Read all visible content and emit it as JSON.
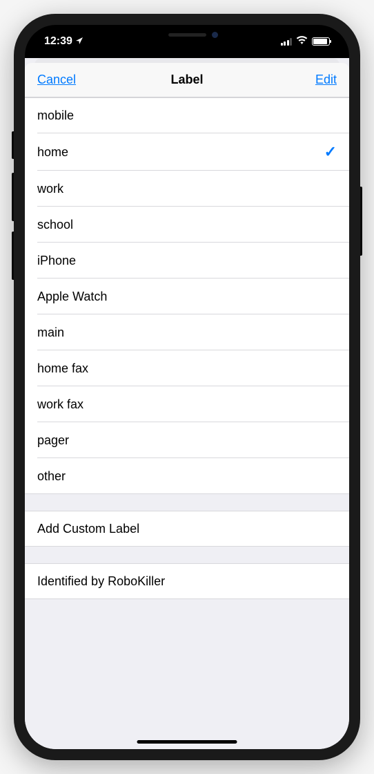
{
  "status": {
    "time": "12:39"
  },
  "nav": {
    "cancel": "Cancel",
    "title": "Label",
    "edit": "Edit"
  },
  "labels": [
    {
      "text": "mobile",
      "selected": false
    },
    {
      "text": "home",
      "selected": true
    },
    {
      "text": "work",
      "selected": false
    },
    {
      "text": "school",
      "selected": false
    },
    {
      "text": "iPhone",
      "selected": false
    },
    {
      "text": "Apple Watch",
      "selected": false
    },
    {
      "text": "main",
      "selected": false
    },
    {
      "text": "home fax",
      "selected": false
    },
    {
      "text": "work fax",
      "selected": false
    },
    {
      "text": "pager",
      "selected": false
    },
    {
      "text": "other",
      "selected": false
    }
  ],
  "addCustom": "Add Custom Label",
  "customLabels": [
    "Identified by RoboKiller"
  ]
}
